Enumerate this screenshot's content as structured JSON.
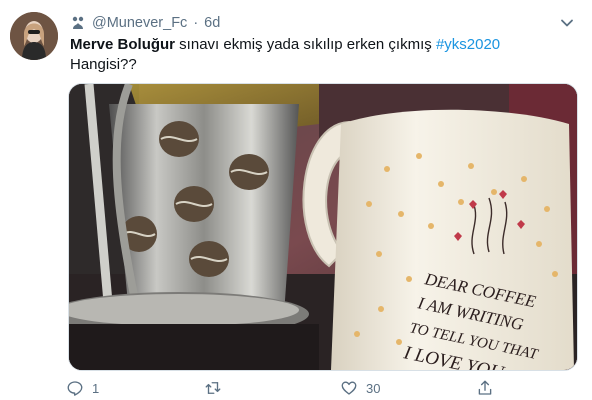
{
  "tweet": {
    "handle": "@Munever_Fc",
    "separator": "·",
    "time": "6d",
    "author": "Merve Boluğur",
    "text_body": " sınavı ekmiş yada sıkılıp erken çıkmış ",
    "hashtag": "#yks2020",
    "text_line2": "Hangisi??",
    "icons": {
      "reference": "quote-reference-icon",
      "more": "chevron-down-icon",
      "reply": "reply-icon",
      "retweet": "retweet-icon",
      "like": "heart-icon",
      "share": "share-icon"
    },
    "media": {
      "mug_text_lines": [
        "DEAR COFFEE",
        "I AM WRITING",
        "TO TELL YOU THAT",
        "I LOVE YOU"
      ]
    },
    "stats": {
      "replies": "1",
      "retweets": "",
      "likes": "30"
    },
    "colors": {
      "hashtag": "#1b95e0",
      "muted": "#5b7083"
    }
  }
}
